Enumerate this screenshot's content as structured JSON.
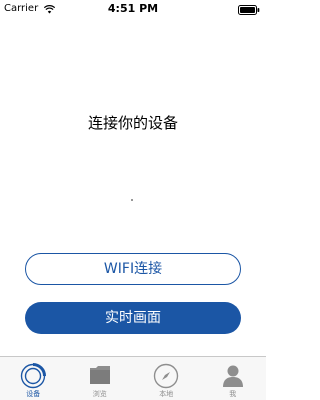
{
  "status_bar": {
    "carrier": "Carrier",
    "time": "4:51 PM"
  },
  "main": {
    "title": "连接你的设备",
    "wifi_button": "WIFI连接",
    "live_button": "实时画面"
  },
  "tab_bar": {
    "tabs": [
      {
        "label": "设备",
        "icon": "device-ring-icon",
        "active": true
      },
      {
        "label": "浏览",
        "icon": "folder-icon",
        "active": false
      },
      {
        "label": "本地",
        "icon": "compass-icon",
        "active": false
      },
      {
        "label": "我",
        "icon": "person-icon",
        "active": false
      }
    ]
  },
  "colors": {
    "accent": "#1b56a5",
    "tab_inactive": "#8e8e8e",
    "tab_bar_bg": "#f7f7f7"
  }
}
